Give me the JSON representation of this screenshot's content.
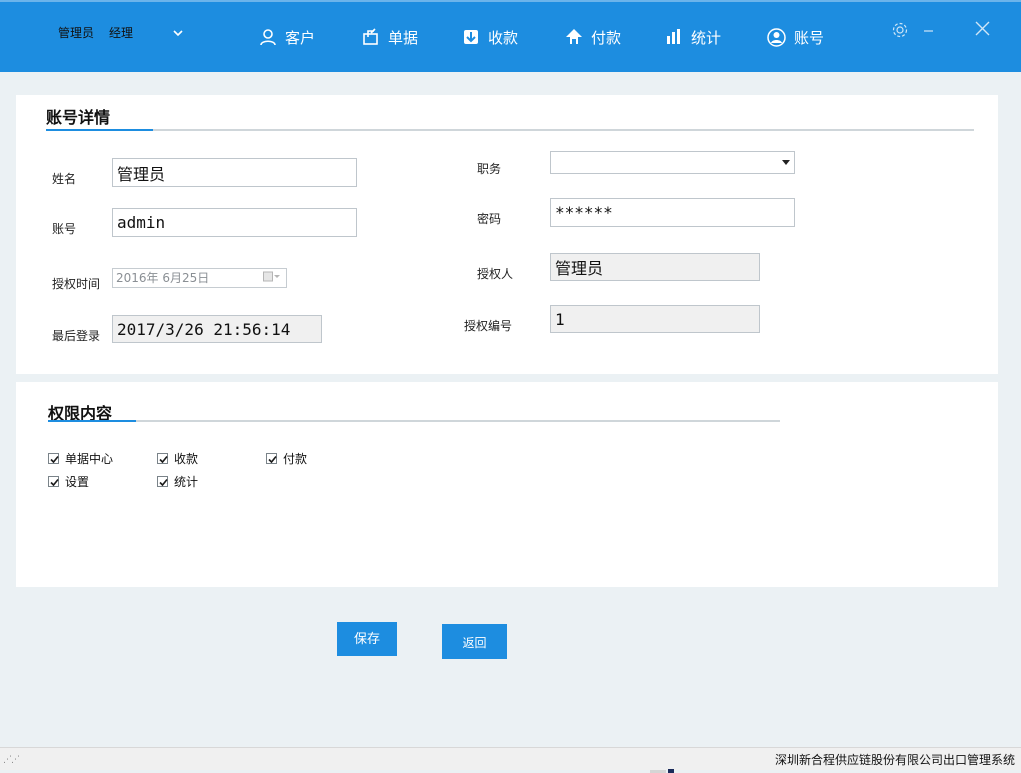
{
  "header": {
    "user_name": "管理员",
    "user_role": "经理",
    "nav": [
      {
        "label": "客户",
        "icon": "user-icon"
      },
      {
        "label": "单据",
        "icon": "document-icon"
      },
      {
        "label": "收款",
        "icon": "receive-payment-icon"
      },
      {
        "label": "付款",
        "icon": "send-payment-icon"
      },
      {
        "label": "统计",
        "icon": "bar-chart-icon"
      },
      {
        "label": "账号",
        "icon": "account-icon"
      }
    ],
    "window_controls": [
      "gear-icon",
      "minimize-icon",
      "close-icon"
    ]
  },
  "account": {
    "section_title": "账号详情",
    "name_label": "姓名",
    "name_value": "管理员",
    "position_label": "职务",
    "position_value": "",
    "account_label": "账号",
    "account_value": "admin",
    "password_label": "密码",
    "password_value": "******",
    "auth_time_label": "授权时间",
    "auth_time_value": "2016年  6月25日",
    "authorizer_label": "授权人",
    "authorizer_value": "管理员",
    "last_login_label": "最后登录",
    "last_login_value": "2017/3/26 21:56:14",
    "auth_no_label": "授权编号",
    "auth_no_value": "1"
  },
  "permissions": {
    "section_title": "权限内容",
    "items": [
      {
        "label": "单据中心",
        "checked": true
      },
      {
        "label": "收款",
        "checked": true
      },
      {
        "label": "付款",
        "checked": true
      },
      {
        "label": "设置",
        "checked": true
      },
      {
        "label": "统计",
        "checked": true
      }
    ]
  },
  "actions": {
    "save_label": "保存",
    "back_label": "返回"
  },
  "status_bar": {
    "text": "深圳新合程供应链股份有限公司出口管理系统"
  },
  "colors": {
    "accent": "#1d8de0",
    "background": "#ebf1f4"
  }
}
